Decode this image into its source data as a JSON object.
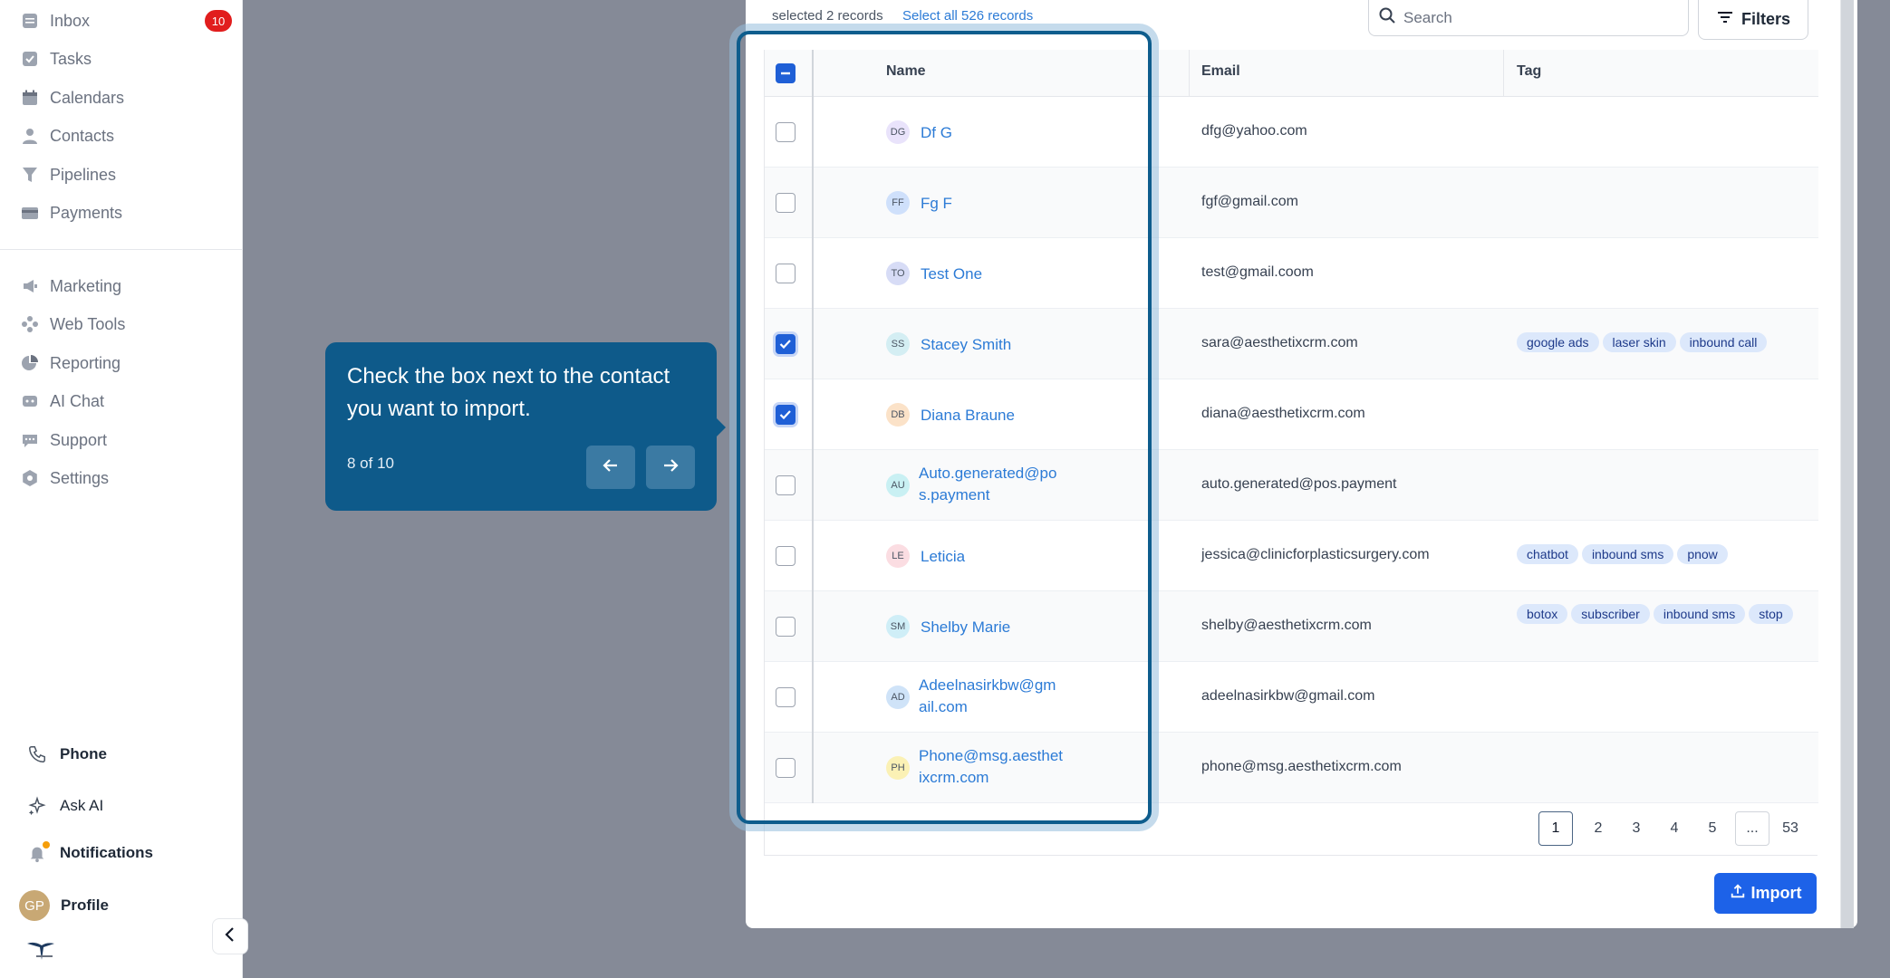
{
  "sidebar": {
    "items": [
      {
        "label": "Inbox",
        "icon": "inbox-icon",
        "badge": "10"
      },
      {
        "label": "Tasks",
        "icon": "tasks-icon"
      },
      {
        "label": "Calendars",
        "icon": "calendar-icon"
      },
      {
        "label": "Contacts",
        "icon": "contacts-icon"
      },
      {
        "label": "Pipelines",
        "icon": "pipelines-icon"
      },
      {
        "label": "Payments",
        "icon": "payments-icon"
      }
    ],
    "items2": [
      {
        "label": "Marketing",
        "icon": "marketing-icon"
      },
      {
        "label": "Web Tools",
        "icon": "web-tools-icon"
      },
      {
        "label": "Reporting",
        "icon": "reporting-icon"
      },
      {
        "label": "AI Chat",
        "icon": "ai-chat-icon"
      },
      {
        "label": "Support",
        "icon": "support-icon"
      },
      {
        "label": "Settings",
        "icon": "settings-icon"
      }
    ],
    "bottom": {
      "phone": "Phone",
      "ask_ai": "Ask AI",
      "notifications": "Notifications",
      "profile": "Profile",
      "profile_initials": "GP"
    }
  },
  "toolbar": {
    "selected_text": "selected 2 records",
    "select_all": "Select all 526 records",
    "search_placeholder": "Search",
    "filters_label": "Filters"
  },
  "table": {
    "columns": [
      "Name",
      "Email",
      "Tag"
    ],
    "rows": [
      {
        "initials": "DG",
        "name": "Df G",
        "email": "dfg@yahoo.com",
        "checked": false,
        "tags": [],
        "avatar_color": "#e9e3fb"
      },
      {
        "initials": "FF",
        "name": "Fg F",
        "email": "fgf@gmail.com",
        "checked": false,
        "tags": [],
        "avatar_color": "#cfe0fb"
      },
      {
        "initials": "TO",
        "name": "Test One",
        "email": "test@gmail.coom",
        "checked": false,
        "tags": [],
        "avatar_color": "#d7dcf6"
      },
      {
        "initials": "SS",
        "name": "Stacey Smith",
        "email": "sara@aesthetixcrm.com",
        "checked": true,
        "tags": [
          "google ads",
          "laser skin",
          "inbound call"
        ],
        "avatar_color": "#d4eef3"
      },
      {
        "initials": "DB",
        "name": "Diana Braune",
        "email": "diana@aesthetixcrm.com",
        "checked": true,
        "tags": [],
        "avatar_color": "#fbe2c8"
      },
      {
        "initials": "AU",
        "name": "Auto.generated@pos.payment",
        "email": "auto.generated@pos.payment",
        "checked": false,
        "tags": [],
        "avatar_color": "#c9f0f3"
      },
      {
        "initials": "LE",
        "name": "Leticia",
        "email": "jessica@clinicforplasticsurgery.com",
        "checked": false,
        "tags": [
          "chatbot",
          "inbound sms",
          "pnow"
        ],
        "avatar_color": "#fbdde2"
      },
      {
        "initials": "SM",
        "name": "Shelby Marie",
        "email": "shelby@aesthetixcrm.com",
        "checked": false,
        "tags": [
          "botox",
          "subscriber",
          "inbound sms",
          "stop"
        ],
        "avatar_color": "#cfeef7"
      },
      {
        "initials": "AD",
        "name": "Adeelnasirkbw@gmail.com",
        "email": "adeelnasirkbw@gmail.com",
        "checked": false,
        "tags": [],
        "avatar_color": "#cfe3f8"
      },
      {
        "initials": "PH",
        "name": "Phone@msg.aesthetixcrm.com",
        "email": "phone@msg.aesthetixcrm.com",
        "checked": false,
        "tags": [],
        "avatar_color": "#fbf1b5"
      }
    ],
    "name_lines": {
      "5": [
        "Auto.generated@po",
        "s.payment"
      ],
      "8": [
        "Adeelnasirkbw@gm",
        "ail.com"
      ],
      "9": [
        "Phone@msg.aesthet",
        "ixcrm.com"
      ]
    }
  },
  "pagination": {
    "pages": [
      "1",
      "2",
      "3",
      "4",
      "5",
      "...",
      "53"
    ],
    "active": "1"
  },
  "import_label": "Import",
  "tooltip": {
    "text": "Check the box next to the contact you want to import.",
    "step": "8 of 10"
  },
  "colors": {
    "accent": "#1d62e8",
    "link": "#2c7bd6",
    "tooltip_bg": "#0e5a8a",
    "badge": "#e11d1d"
  }
}
